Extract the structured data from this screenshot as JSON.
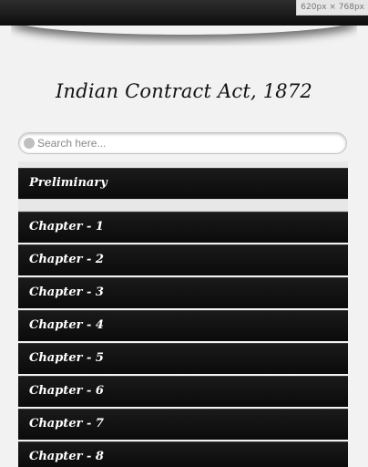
{
  "viewport_badge": "620px × 768px",
  "page_title": "Indian Contract Act, 1872",
  "search": {
    "placeholder": "Search here..."
  },
  "sections": {
    "preliminary": "Preliminary",
    "chapters": [
      "Chapter - 1",
      "Chapter - 2",
      "Chapter - 3",
      "Chapter - 4",
      "Chapter - 5",
      "Chapter - 6",
      "Chapter - 7",
      "Chapter - 8"
    ]
  }
}
